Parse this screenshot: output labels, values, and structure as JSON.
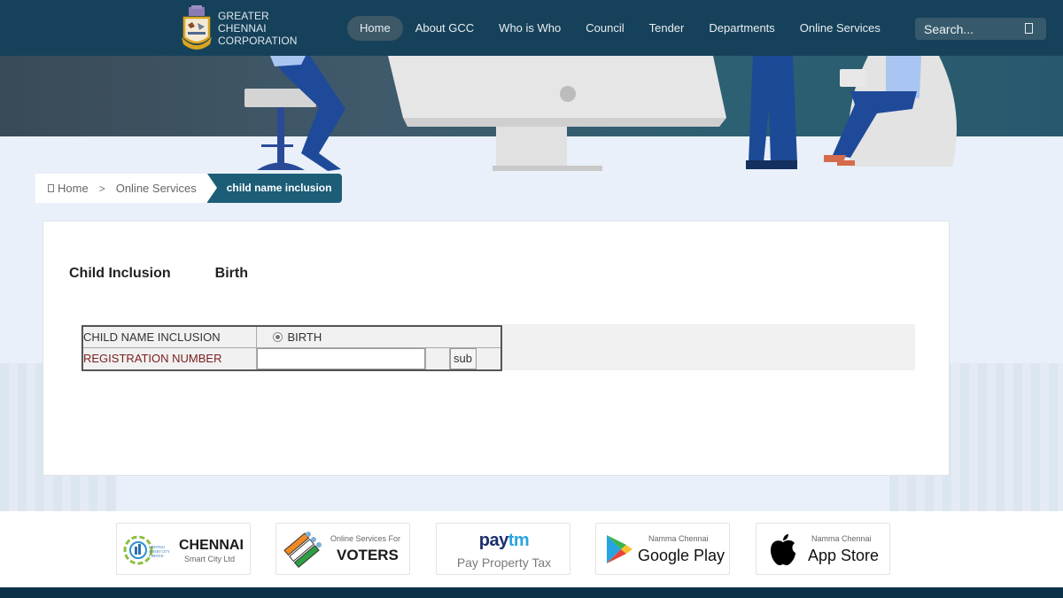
{
  "header": {
    "logo_lines": [
      "GREATER",
      "CHENNAI",
      "CORPORATION"
    ],
    "nav": [
      {
        "label": "Home",
        "active": true
      },
      {
        "label": "About GCC",
        "active": false
      },
      {
        "label": "Who is Who",
        "active": false
      },
      {
        "label": "Council",
        "active": false
      },
      {
        "label": "Tender",
        "active": false
      },
      {
        "label": "Departments",
        "active": false
      },
      {
        "label": "Online Services",
        "active": false
      }
    ],
    "search": {
      "placeholder": "Search...",
      "icon": "search-icon"
    }
  },
  "breadcrumb": {
    "home_icon": "home-icon",
    "home": "Home",
    "separator": ">",
    "parent": "Online Services",
    "current": "child name inclusion"
  },
  "card": {
    "tabs": [
      "Child Inclusion",
      "Birth"
    ],
    "form": {
      "row1_label": "CHILD NAME INCLUSION",
      "radio_label": "BIRTH",
      "radio_checked": true,
      "row2_label": "REGISTRATION NUMBER",
      "reg_value": "",
      "submit_label": "sub"
    }
  },
  "partners": [
    {
      "name": "chennai-smart-city",
      "logo_text": "CHENNAI SMART CITY LIMITED",
      "title": "CHENNAI",
      "subtitle": "Smart City Ltd"
    },
    {
      "name": "voters",
      "top": "Online Services For",
      "title": "VOTERS"
    },
    {
      "name": "paytm",
      "brand": "paytm",
      "subtitle": "Pay Property Tax"
    },
    {
      "name": "google-play",
      "top": "Namma Chennai",
      "title": "Google Play"
    },
    {
      "name": "app-store",
      "top": "Namma Chennai",
      "title": "App Store"
    }
  ],
  "colors": {
    "header_bg": "#16415a",
    "breadcrumb_active": "#1c5d77",
    "red_label": "#7b1d1d",
    "footer_bar": "#0c3048"
  }
}
